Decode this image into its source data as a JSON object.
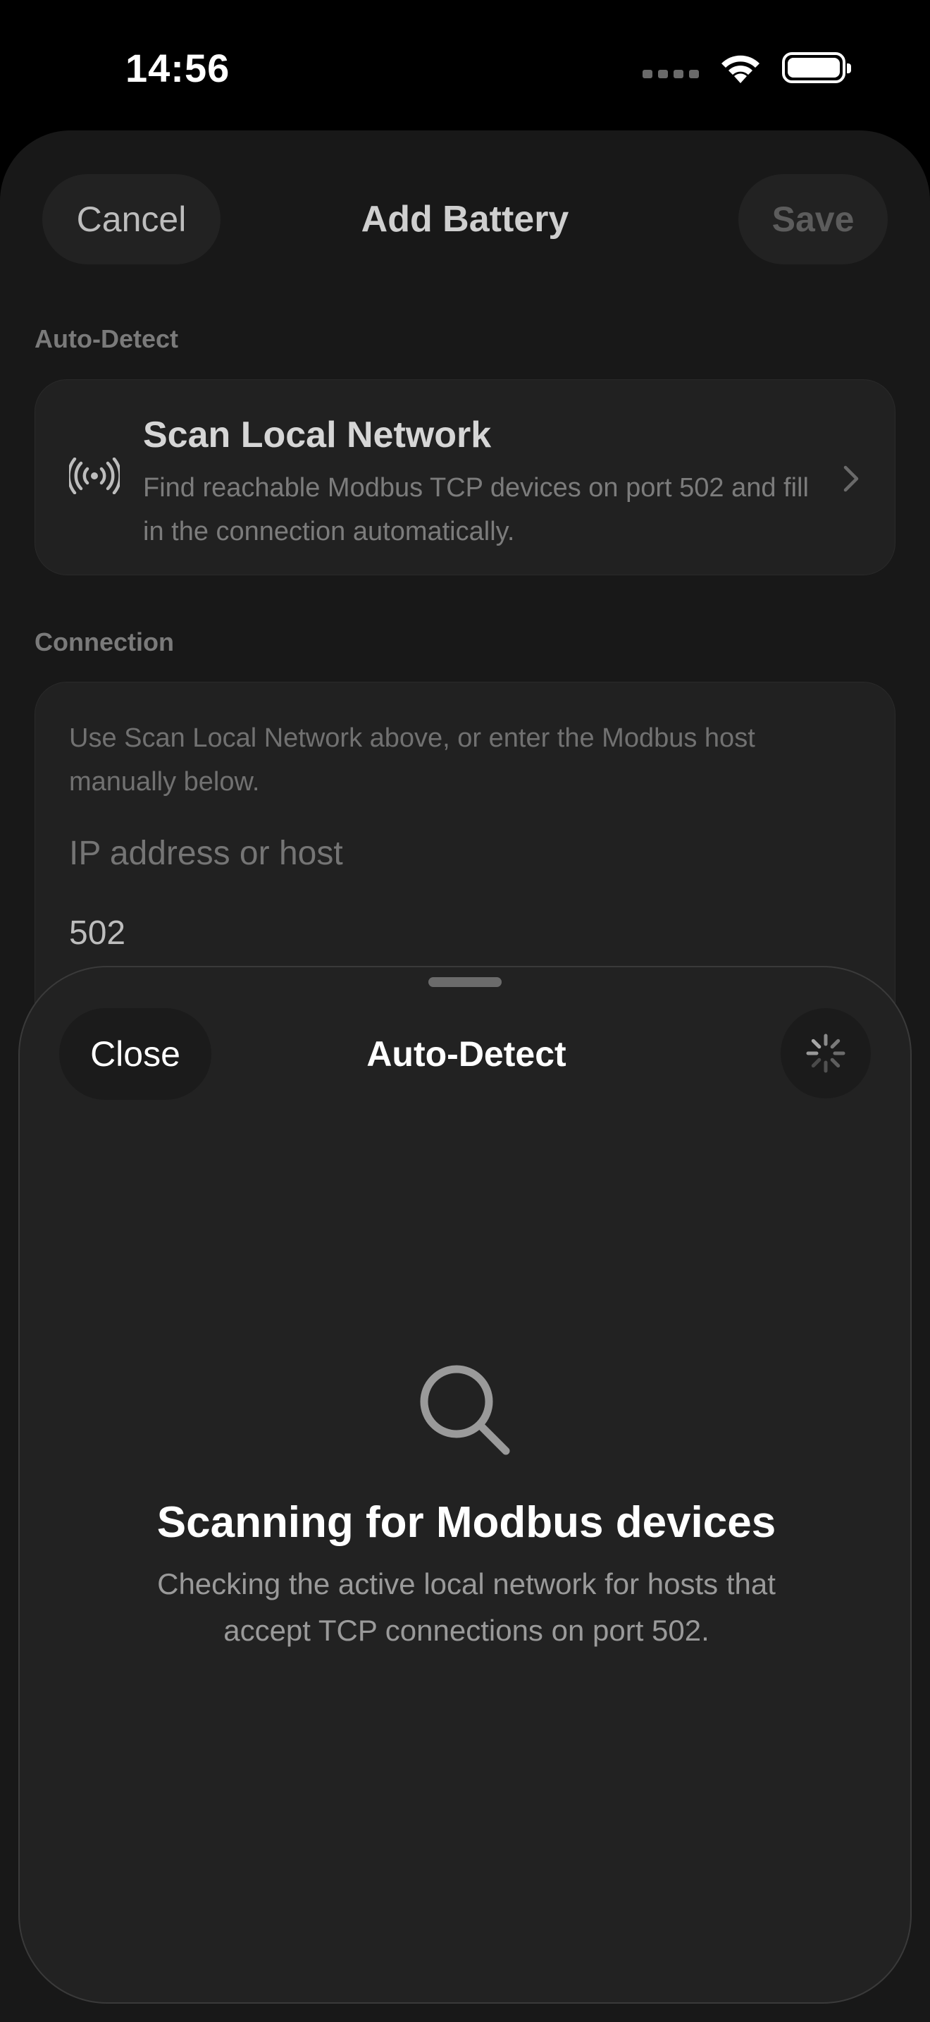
{
  "status_bar": {
    "time": "14:56",
    "icons": [
      "cellular-signal-icon",
      "wifi-icon",
      "battery-icon"
    ]
  },
  "add_battery": {
    "title": "Add Battery",
    "cancel_label": "Cancel",
    "save_label": "Save",
    "auto_detect_section": "Auto-Detect",
    "scan_card": {
      "icon": "antenna-broadcast-icon",
      "title": "Scan Local Network",
      "description": "Find reachable Modbus TCP devices on port 502 and fill in the connection automatically."
    },
    "connection_section": "Connection",
    "connection_card": {
      "hint": "Use Scan Local Network above, or enter the Modbus host manually below.",
      "host_placeholder": "IP address or host",
      "port_value": "502"
    }
  },
  "auto_detect_sheet": {
    "close_label": "Close",
    "title": "Auto-Detect",
    "status_icon": "activity-spinner-icon",
    "empty_state": {
      "icon": "magnifying-glass-icon",
      "heading": "Scanning for Modbus devices",
      "body": "Checking the active local network for hosts that accept TCP connections on port 502."
    }
  },
  "colors": {
    "background": "#000000",
    "sheet": "#222222",
    "card": "#212121",
    "primary_text": "#ffffff",
    "secondary_text": "#9a9a9a"
  }
}
